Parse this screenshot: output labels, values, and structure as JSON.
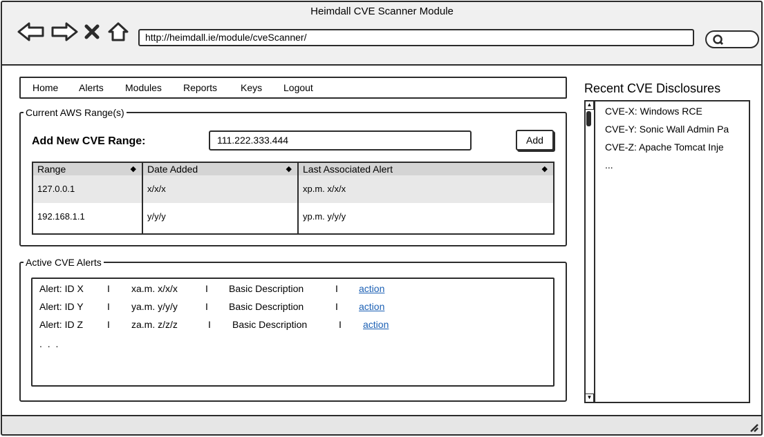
{
  "window": {
    "title": "Heimdall CVE Scanner Module"
  },
  "browser": {
    "url": "http://heimdall.ie/module/cveScanner/"
  },
  "menu": [
    "Home",
    "Alerts",
    "Modules",
    "Reports",
    "Keys",
    "Logout"
  ],
  "current_range": {
    "legend": "Current AWS Range(s)",
    "add_label": "Add New CVE Range:",
    "input_value": "111.222.333.444",
    "add_button": "Add",
    "columns": [
      "Range",
      "Date Added",
      "Last Associated Alert"
    ],
    "rows": [
      [
        "127.0.0.1",
        "x/x/x",
        "xp.m. x/x/x"
      ],
      [
        "192.168.1.1",
        "y/y/y",
        "yp.m. y/y/y"
      ]
    ]
  },
  "active_alerts": {
    "legend": "Active CVE Alerts",
    "separator": "I",
    "rows": [
      {
        "id": "Alert: ID X",
        "time": "xa.m. x/x/x",
        "description": "Basic Description",
        "action": "action"
      },
      {
        "id": "Alert: ID Y",
        "time": "ya.m. y/y/y",
        "description": "Basic Description",
        "action": "action"
      },
      {
        "id": "Alert: ID Z",
        "time": "za.m. z/z/z",
        "description": "Basic Description",
        "action": "action"
      }
    ],
    "more": ". . ."
  },
  "recent": {
    "title": "Recent CVE Disclosures",
    "items": [
      "CVE-X: Windows RCE",
      "CVE-Y: Sonic Wall Admin Pa",
      "CVE-Z: Apache Tomcat Inje",
      "..."
    ]
  },
  "icons": {
    "back": "back-arrow-icon",
    "forward": "forward-arrow-icon",
    "stop": "close-icon",
    "home": "home-icon",
    "search": "search-icon",
    "resize": "resize-grip-icon"
  }
}
